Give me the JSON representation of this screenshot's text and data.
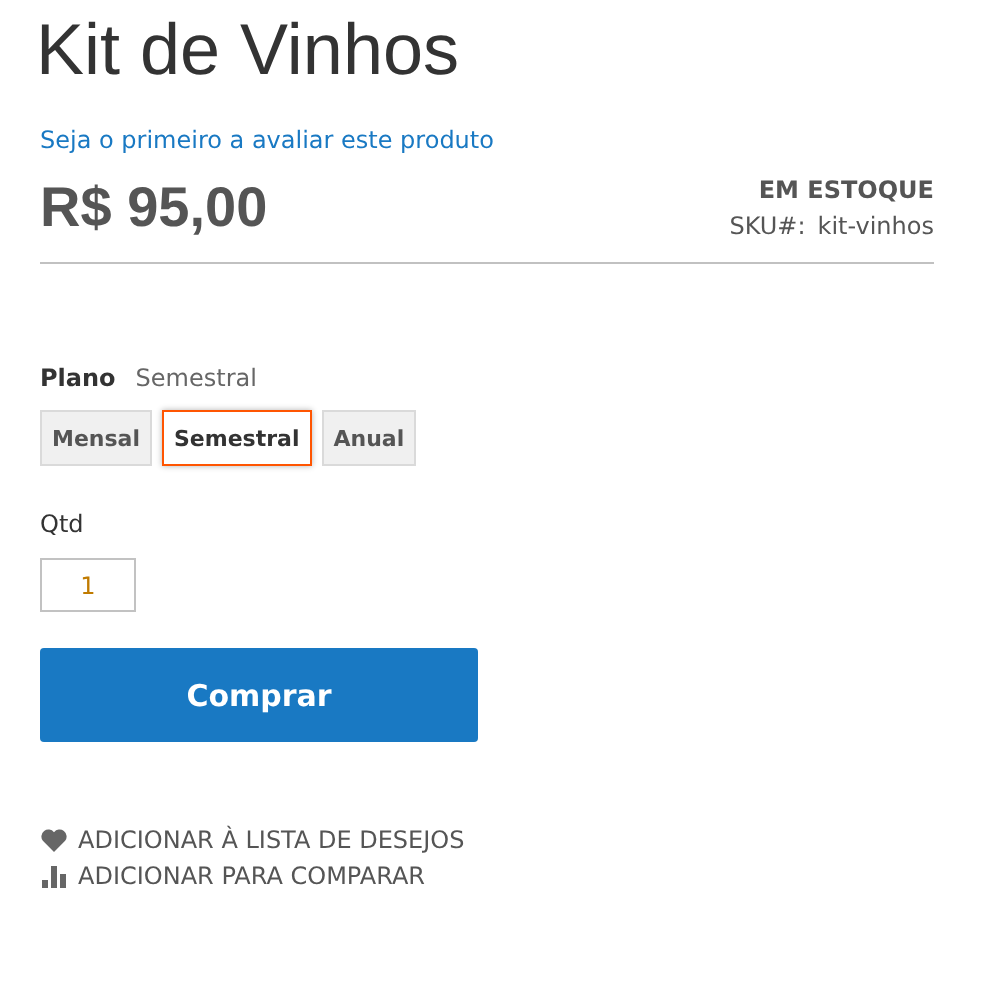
{
  "product": {
    "title": "Kit de Vinhos",
    "review_link": "Seja o primeiro a avaliar este produto",
    "price": "R$ 95,00",
    "stock": "EM ESTOQUE",
    "sku_label": "SKU#:",
    "sku": "kit-vinhos"
  },
  "plan": {
    "label": "Plano",
    "value": "Semestral",
    "options": [
      {
        "label": "Mensal",
        "selected": false
      },
      {
        "label": "Semestral",
        "selected": true
      },
      {
        "label": "Anual",
        "selected": false
      }
    ]
  },
  "quantity": {
    "label": "Qtd",
    "value": "1"
  },
  "buy_button": "Comprar",
  "actions": [
    {
      "kind": "wishlist",
      "label": "ADICIONAR À LISTA DE DESEJOS"
    },
    {
      "kind": "compare",
      "label": "ADICIONAR PARA COMPARAR"
    }
  ]
}
